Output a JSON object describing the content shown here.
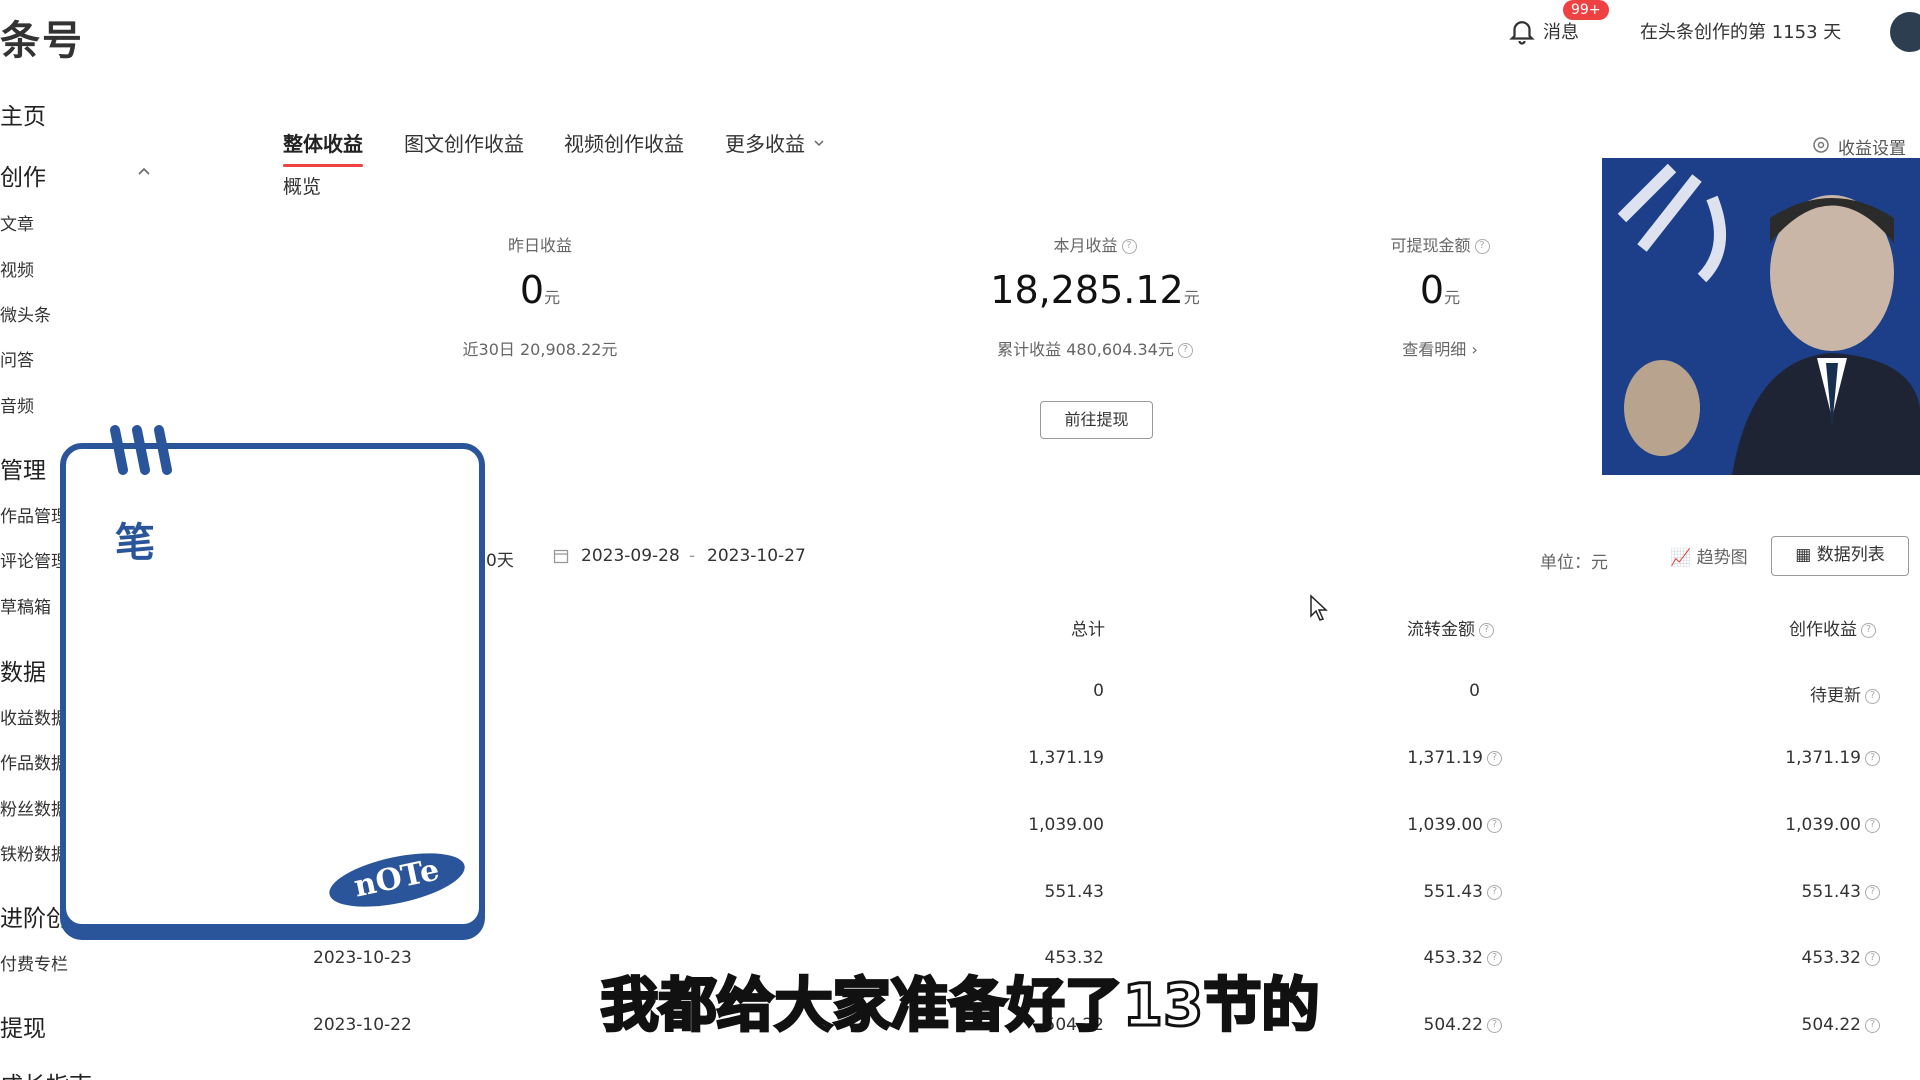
{
  "header": {
    "logo": "条号",
    "notifications_badge": "99+",
    "messages_label": "消息",
    "creation_days": "在头条创作的第 1153 天"
  },
  "sidebar": {
    "home": "主页",
    "create": "创作",
    "create_items": [
      "文章",
      "视频",
      "微头条",
      "问答",
      "音频"
    ],
    "manage": "管理",
    "manage_items": [
      "作品管理",
      "评论管理",
      "草稿箱"
    ],
    "data": "数据",
    "data_items": [
      "收益数据",
      "作品数据",
      "粉丝数据",
      "铁粉数据"
    ],
    "advanced": "进阶创作",
    "advanced_items": [
      "付费专栏"
    ],
    "withdraw": "提现",
    "growth": "成长指南"
  },
  "tabs": {
    "items": [
      "整体收益",
      "图文创作收益",
      "视频创作收益",
      "更多收益"
    ],
    "subtab": "概览",
    "settings": "收益设置"
  },
  "stats": {
    "yesterday": {
      "label": "昨日收益",
      "value": "0",
      "unit": "元",
      "sub": "近30日 20,908.22元"
    },
    "month": {
      "label": "本月收益",
      "value": "18,285.12",
      "unit": "元",
      "sub": "累计收益 480,604.34元"
    },
    "withdrawable": {
      "label": "可提现金额",
      "value": "0",
      "unit": "元",
      "sub": "查看明细 ›"
    },
    "withdraw_button": "前往提现"
  },
  "range": {
    "preset_tail": "0天",
    "start": "2023-09-28",
    "separator": "-",
    "end": "2023-10-27",
    "unit": "单位：元",
    "trend": "趋势图",
    "table": "数据列表"
  },
  "table": {
    "headers": [
      "总计",
      "流转金额",
      "创作收益"
    ],
    "rows": [
      {
        "date": "",
        "total": "0",
        "flow": "0",
        "creation": "待更新"
      },
      {
        "date": "",
        "total": "1,371.19",
        "flow": "1,371.19",
        "creation": "1,371.19"
      },
      {
        "date": "",
        "total": "1,039.00",
        "flow": "1,039.00",
        "creation": "1,039.00"
      },
      {
        "date": "",
        "total": "551.43",
        "flow": "551.43",
        "creation": "551.43"
      },
      {
        "date": "2023-10-23",
        "total": "453.32",
        "flow": "453.32",
        "creation": "453.32"
      },
      {
        "date": "2023-10-22",
        "total": "504.22",
        "flow": "504.22",
        "creation": "504.22"
      }
    ]
  },
  "overlay": {
    "subtitle": "我都给大家准备好了13节的",
    "note_title": "笔",
    "note_badge": "nOTe"
  },
  "colors": {
    "accent": "#f04142",
    "note_blue": "#2a559a"
  }
}
